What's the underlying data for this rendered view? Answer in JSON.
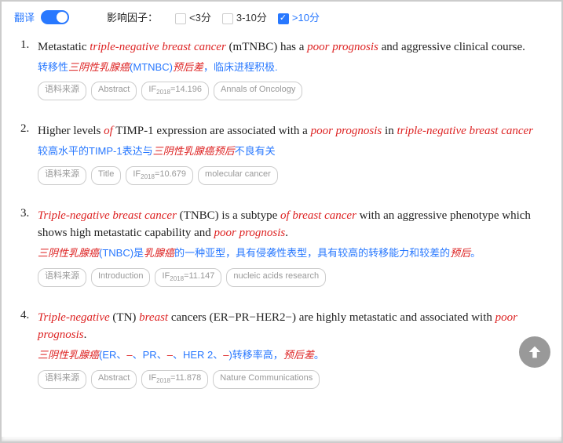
{
  "filter": {
    "translate_label": "翻译",
    "factor_label": "影响因子：",
    "options": [
      {
        "label": "<3分",
        "checked": false
      },
      {
        "label": "3-10分",
        "checked": false
      },
      {
        "label": ">10分",
        "checked": true
      }
    ]
  },
  "tag_labels": {
    "source": "语料来源",
    "if_prefix": "IF",
    "if_year": "2018"
  },
  "results": [
    {
      "num": "1.",
      "english_parts": [
        {
          "t": "Metastatic "
        },
        {
          "t": "triple-negative breast cancer",
          "hl": true
        },
        {
          "t": " (mTNBC) has a "
        },
        {
          "t": "poor prognosis",
          "hl": true
        },
        {
          "t": " and aggressive clinical course."
        }
      ],
      "chinese_parts": [
        {
          "t": "转移性"
        },
        {
          "t": "三阴性乳腺癌",
          "hl": true
        },
        {
          "t": "(MTNBC)"
        },
        {
          "t": "预后差",
          "hl": true
        },
        {
          "t": "，临床进程积极."
        }
      ],
      "section": "Abstract",
      "if": "14.196",
      "journal": "Annals of Oncology"
    },
    {
      "num": "2.",
      "english_parts": [
        {
          "t": "Higher levels "
        },
        {
          "t": "of",
          "hl": true
        },
        {
          "t": " TIMP-1 expression are associated with a "
        },
        {
          "t": "poor prognosis",
          "hl": true
        },
        {
          "t": " in "
        },
        {
          "t": "triple-negative breast cancer",
          "hl": true
        }
      ],
      "chinese_parts": [
        {
          "t": "较高水平的TIMP-1表达与"
        },
        {
          "t": "三阴性乳腺癌预后",
          "hl": true
        },
        {
          "t": "不良有关"
        }
      ],
      "section": "Title",
      "if": "10.679",
      "journal": "molecular cancer"
    },
    {
      "num": "3.",
      "english_parts": [
        {
          "t": "Triple-negative breast cancer",
          "hl": true
        },
        {
          "t": " (TNBC) is a subtype "
        },
        {
          "t": "of breast cancer",
          "hl": true
        },
        {
          "t": " with an aggressive phenotype which shows high metastatic capability and "
        },
        {
          "t": "poor prognosis",
          "hl": true
        },
        {
          "t": "."
        }
      ],
      "chinese_parts": [
        {
          "t": "三阴性乳腺癌",
          "hl": true
        },
        {
          "t": "(TNBC)是"
        },
        {
          "t": "乳腺癌",
          "hl": true
        },
        {
          "t": "的一种亚型，具有侵袭性表型，具有较高的转移能力和较差的"
        },
        {
          "t": "预后",
          "hl": true
        },
        {
          "t": "。"
        }
      ],
      "section": "Introduction",
      "if": "11.147",
      "journal": "nucleic acids research"
    },
    {
      "num": "4.",
      "english_parts": [
        {
          "t": "Triple-negative",
          "hl": true
        },
        {
          "t": " (TN) "
        },
        {
          "t": "breast",
          "hl": true
        },
        {
          "t": " cancers (ER−PR−HER2−) are highly metastatic and associated with "
        },
        {
          "t": "poor prognosis",
          "hl": true
        },
        {
          "t": "."
        }
      ],
      "chinese_parts": [
        {
          "t": "三阴性乳腺癌",
          "hl": true
        },
        {
          "t": "(ER、"
        },
        {
          "t": "–",
          "hl": true
        },
        {
          "t": "、PR、"
        },
        {
          "t": "–",
          "hl": true
        },
        {
          "t": "、HER 2、"
        },
        {
          "t": "–",
          "hl": true
        },
        {
          "t": ")转移率高，"
        },
        {
          "t": "预后差",
          "hl": true
        },
        {
          "t": "。"
        }
      ],
      "section": "Abstract",
      "if": "11.878",
      "journal": "Nature Communications"
    }
  ]
}
